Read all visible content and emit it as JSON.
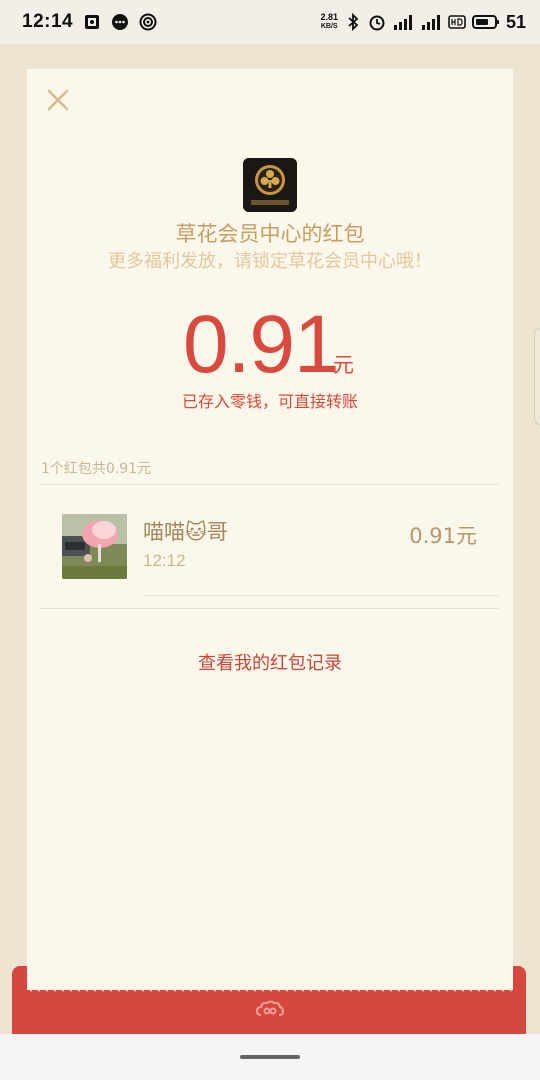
{
  "status_bar": {
    "time": "12:14",
    "net_speed_value": "2.81",
    "net_speed_unit": "KB/S",
    "battery_level": "51"
  },
  "packet": {
    "sender_title": "草花会员中心的红包",
    "subtitle": "更多福利发放，请锁定草花会员中心哦！",
    "amount": "0.91",
    "amount_unit": "元",
    "stored_note": "已存入零钱，可直接转账",
    "count_summary": "1个红包共0.91元"
  },
  "receivers": [
    {
      "name": "喵喵🐱哥",
      "time": "12:12",
      "amount": "0.91元"
    }
  ],
  "actions": {
    "view_records": "查看我的红包记录"
  },
  "colors": {
    "accent_red": "#d9493d",
    "card_bg": "#fbf7ea",
    "gold_text": "#c79e62"
  }
}
